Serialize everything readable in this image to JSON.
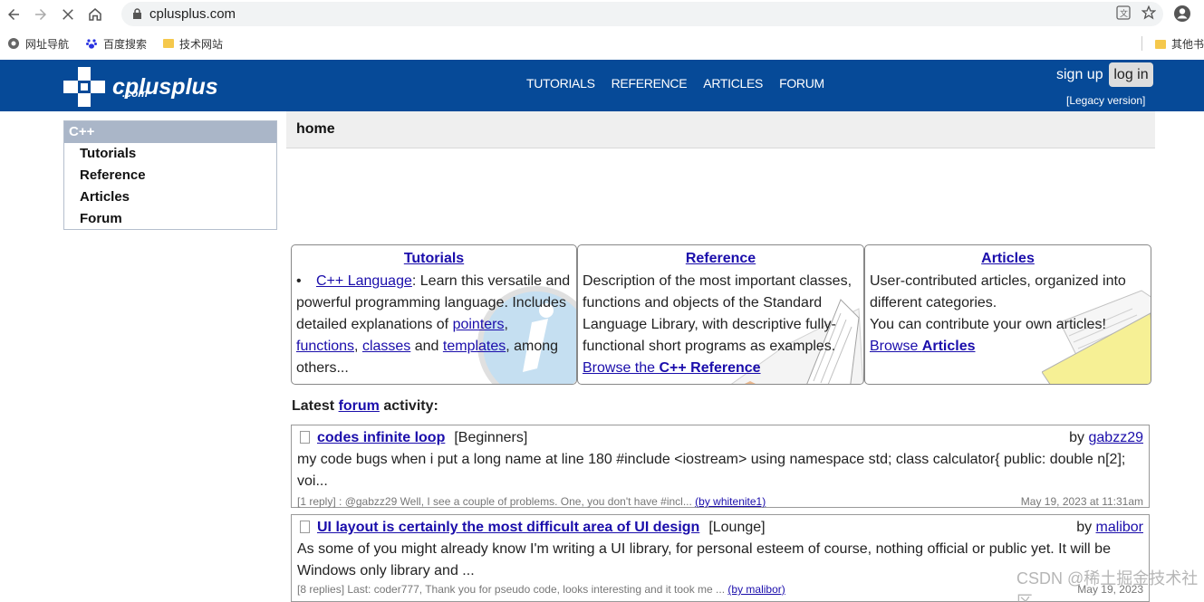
{
  "browser": {
    "url": "cplusplus.com",
    "bookmarks": [
      "网址导航",
      "百度搜索",
      "技术网站"
    ],
    "bookmarks_other": "其他书"
  },
  "site": {
    "logo_main": "cplusplus",
    "logo_sub": ".com",
    "nav": [
      "TUTORIALS",
      "REFERENCE",
      "ARTICLES",
      "FORUM"
    ],
    "sign_up": "sign up",
    "log_in": "log in",
    "legacy": "[Legacy version]"
  },
  "leftmenu": {
    "head": "C++",
    "items": [
      "Tutorials",
      "Reference",
      "Articles",
      "Forum"
    ]
  },
  "page_title": "home",
  "boxes": {
    "tutorials": {
      "title": "Tutorials",
      "link_lang": "C++ Language",
      "t1": ": Learn this versatile and powerful programming language. Includes detailed explanations of ",
      "link_pointers": "pointers",
      "sep1": ",",
      "link_functions": "functions",
      "sep2": ", ",
      "link_classes": "classes",
      "t2": " and ",
      "link_templates": "templates",
      "t3": ", among others..."
    },
    "reference": {
      "title": "Reference",
      "text": "Description of the most important classes, functions and objects of the Standard Language Library, with descriptive fully-functional short programs as examples.",
      "browse_prefix": "Browse the ",
      "browse_bold": "C++ Reference"
    },
    "articles": {
      "title": "Articles",
      "text1": "User-contributed articles, organized into different categories.",
      "text2": "You can contribute your own articles!",
      "browse_prefix": "Browse ",
      "browse_bold": "Articles"
    }
  },
  "latest": {
    "prefix": "Latest ",
    "link": "forum",
    "suffix": " activity:"
  },
  "posts": [
    {
      "title": "codes infinite loop",
      "forum": "[Beginners]",
      "by_prefix": "by ",
      "author": "gabzz29",
      "body": "my code bugs when i put a long name at line 180 #include <iostream> using namespace std; class calculator{ public: double n[2]; voi...",
      "meta": "[1 reply] : @gabzz29 Well, I see a couple of problems. One, you don't have #incl...",
      "meta_by": "(by whitenite1)",
      "date": "May 19, 2023 at 11:31am"
    },
    {
      "title": "UI layout is certainly the most difficult area of UI design",
      "forum": "[Lounge]",
      "by_prefix": "by ",
      "author": "malibor",
      "body": "As some of you might already know I'm writing a UI library, for personal esteem of course, nothing official or public yet. It will be Windows only library and ...",
      "meta": "[8 replies] Last: coder777, Thank you for pseudo code, looks interesting and it took me ...",
      "meta_by": "(by malibor)",
      "date": "May 19, 2023"
    }
  ],
  "watermark": "CSDN @稀土掘金技术社区"
}
